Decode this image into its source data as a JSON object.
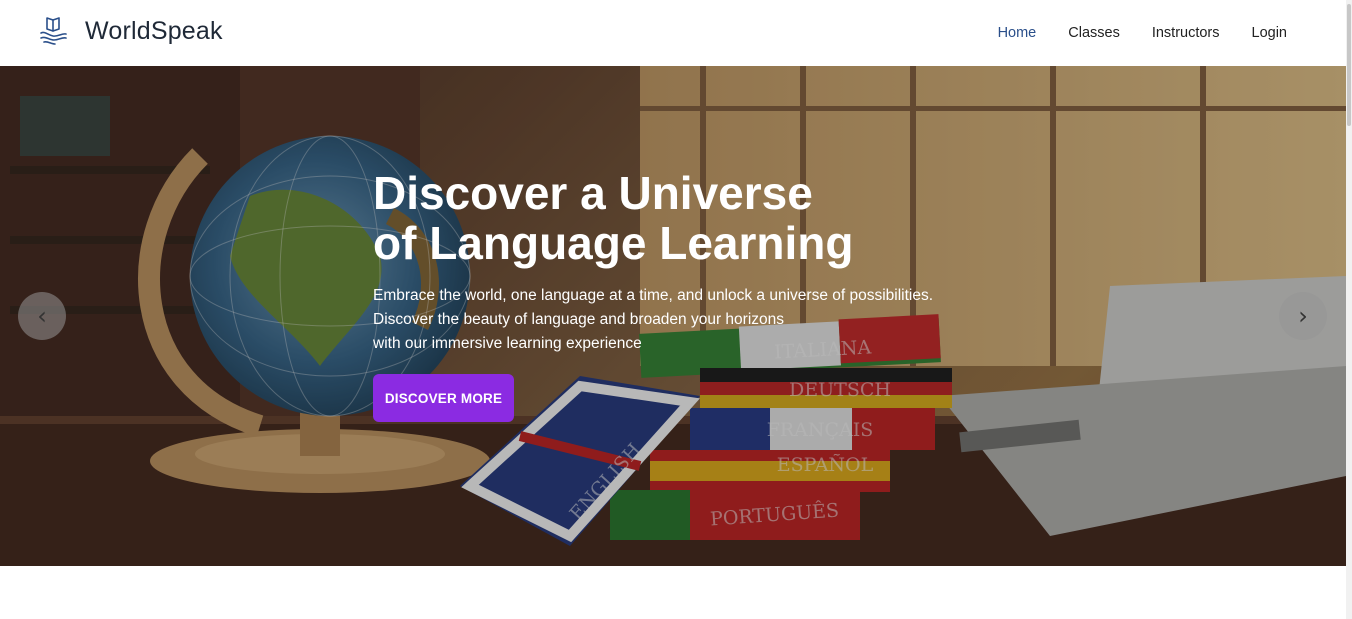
{
  "brand": {
    "name": "WorldSpeak",
    "icon": "book-hand-icon"
  },
  "nav": {
    "items": [
      "Home",
      "Classes",
      "Instructors",
      "Login"
    ],
    "active": "Home"
  },
  "hero": {
    "title_line1": "Discover a Universe",
    "title_line2": "of Language Learning",
    "text_line1": "Embrace the world, one language at a time, and unlock a universe of possibilities.",
    "text_line2": "Discover the beauty of language and broaden your horizons",
    "text_line3": "with our immersive learning experience",
    "cta_label": "DISCOVER MORE",
    "prev_icon": "chevron-left-icon",
    "next_icon": "chevron-right-icon",
    "prev_glyph": "‹",
    "next_glyph": "›",
    "book_labels": [
      "ITALIANA",
      "DEUTSCH",
      "FRANÇAIS",
      "ESPAÑOL",
      "PORTUGUÊS",
      "ENGLISH"
    ]
  },
  "colors": {
    "accent": "#8b2be2",
    "nav_active": "#2a4f8a",
    "text_dark": "#1f2937"
  }
}
